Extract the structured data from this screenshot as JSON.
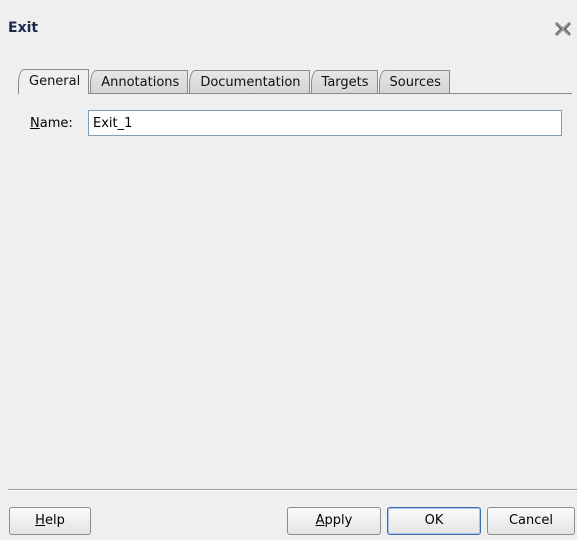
{
  "window": {
    "title": "Exit",
    "close_icon": "close-x-icon"
  },
  "tabs": [
    {
      "label": "General",
      "active": true
    },
    {
      "label": "Annotations",
      "active": false
    },
    {
      "label": "Documentation",
      "active": false
    },
    {
      "label": "Targets",
      "active": false
    },
    {
      "label": "Sources",
      "active": false
    }
  ],
  "general": {
    "name_label_mnemonic": "N",
    "name_label_rest": "ame:",
    "name_value": "Exit_1"
  },
  "buttons": {
    "help_mnemonic": "H",
    "help_rest": "elp",
    "apply_mnemonic": "A",
    "apply_rest": "pply",
    "ok": "OK",
    "cancel": "Cancel"
  }
}
